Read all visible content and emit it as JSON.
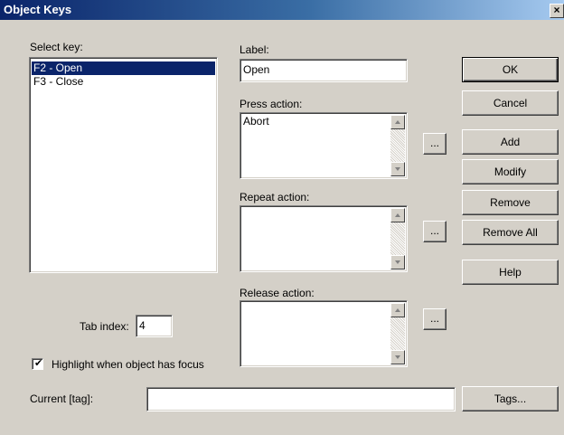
{
  "window": {
    "title": "Object Keys",
    "close_glyph": "×"
  },
  "select_key": {
    "label": "Select key:",
    "items": [
      "F2 - Open",
      "F3 - Close"
    ],
    "selected_index": 0
  },
  "label_field": {
    "label": "Label:",
    "value": "Open"
  },
  "press_action": {
    "label": "Press action:",
    "value": "Abort",
    "browse_label": "..."
  },
  "repeat_action": {
    "label": "Repeat action:",
    "value": "",
    "browse_label": "..."
  },
  "release_action": {
    "label": "Release action:",
    "value": "",
    "browse_label": "..."
  },
  "buttons": {
    "ok": "OK",
    "cancel": "Cancel",
    "add": "Add",
    "modify": "Modify",
    "remove": "Remove",
    "remove_all": "Remove All",
    "help": "Help",
    "tags": "Tags..."
  },
  "tab_index": {
    "label": "Tab index:",
    "value": "4"
  },
  "highlight": {
    "label": "Highlight when object has focus",
    "checked": true,
    "check_glyph": "✔"
  },
  "current_tag": {
    "label": "Current [tag]:",
    "value": ""
  },
  "colors": {
    "dialog_face": "#d4d0c8",
    "title_bar": "#0a246a",
    "selection": "#0a246a"
  }
}
